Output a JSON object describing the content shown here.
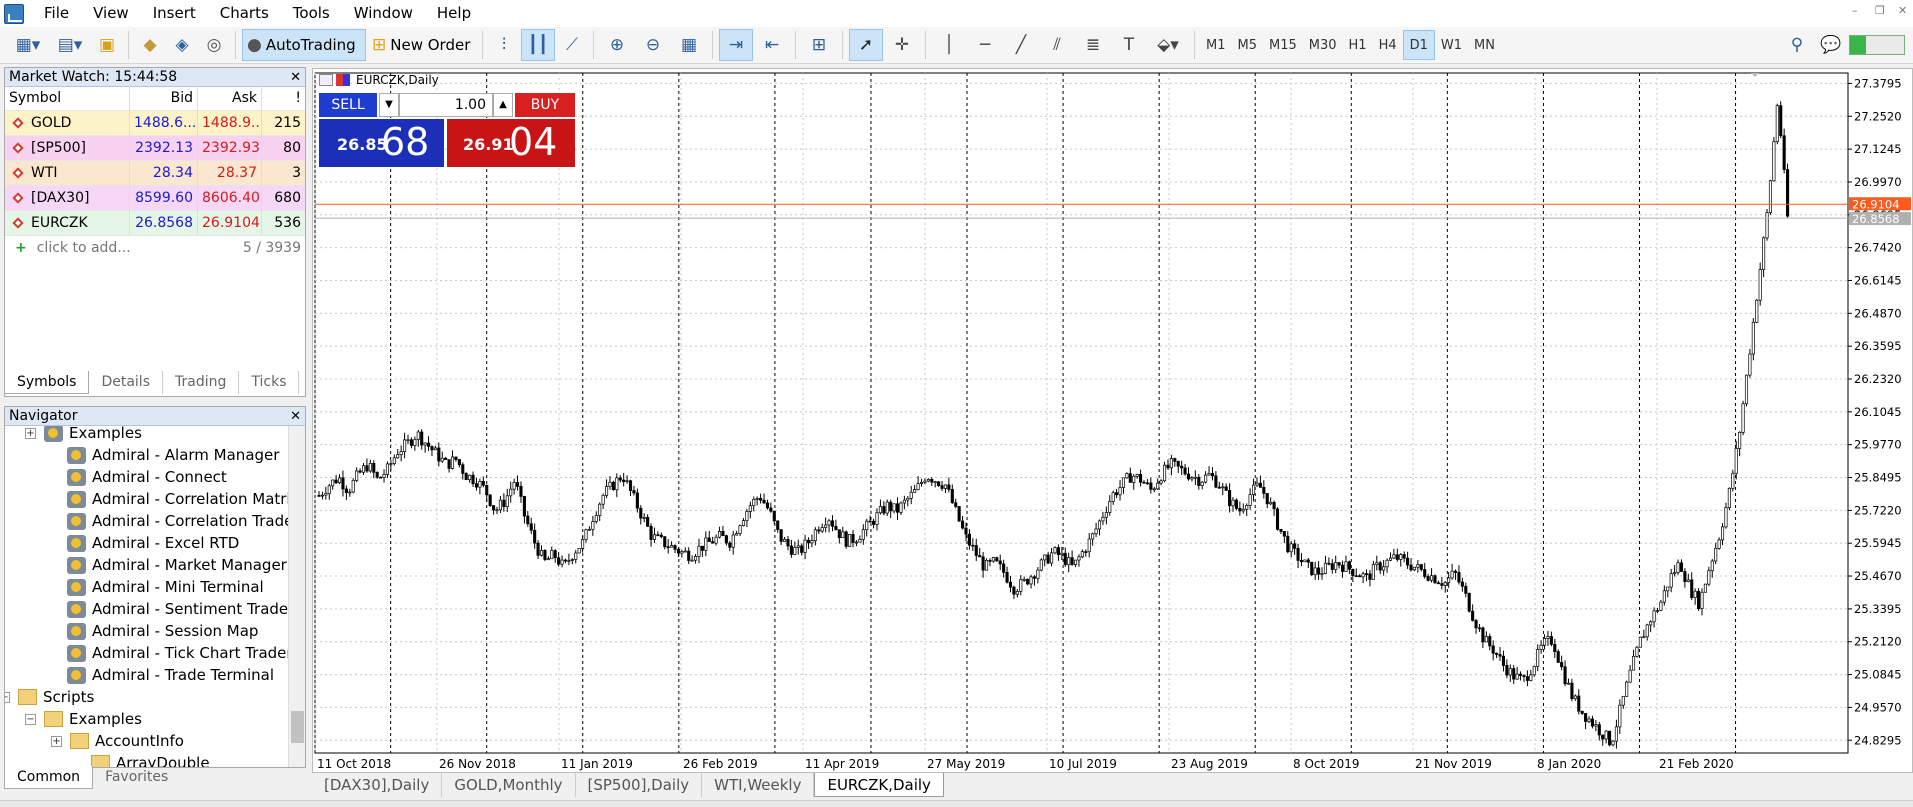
{
  "menu": [
    "File",
    "View",
    "Insert",
    "Charts",
    "Tools",
    "Window",
    "Help"
  ],
  "toolbar": {
    "autotrading": "AutoTrading",
    "new_order": "New Order",
    "timeframes": [
      "M1",
      "M5",
      "M15",
      "M30",
      "H1",
      "H4",
      "D1",
      "W1",
      "MN"
    ],
    "active_tf": "D1"
  },
  "market_watch": {
    "title": "Market Watch: 15:44:58",
    "columns": [
      "Symbol",
      "Bid",
      "Ask",
      "!"
    ],
    "rows": [
      {
        "symbol": "GOLD",
        "bid": "1488.6...",
        "ask": "1488.9...",
        "spread": "215",
        "bg": "#fdf3c9"
      },
      {
        "symbol": "[SP500]",
        "bid": "2392.13",
        "ask": "2392.93",
        "spread": "80",
        "bg": "#f8d3f1"
      },
      {
        "symbol": "WTI",
        "bid": "28.34",
        "ask": "28.37",
        "spread": "3",
        "bg": "#fbe6cf"
      },
      {
        "symbol": "[DAX30]",
        "bid": "8599.60",
        "ask": "8606.40",
        "spread": "680",
        "bg": "#f6d8f6"
      },
      {
        "symbol": "EURCZK",
        "bid": "26.8568",
        "ask": "26.9104",
        "spread": "536",
        "bg": "#e6f6e6"
      }
    ],
    "add_label": "click to add...",
    "count": "5 / 3939",
    "tabs": [
      "Symbols",
      "Details",
      "Trading",
      "Ticks"
    ]
  },
  "navigator": {
    "title": "Navigator",
    "items": [
      "Examples",
      "Admiral - Alarm Manager",
      "Admiral - Connect",
      "Admiral - Correlation Matrix",
      "Admiral - Correlation Trader",
      "Admiral - Excel RTD",
      "Admiral - Market Manager",
      "Admiral - Mini Terminal",
      "Admiral - Sentiment Trader",
      "Admiral - Session Map",
      "Admiral - Tick Chart Trader",
      "Admiral - Trade Terminal",
      "Scripts",
      "Examples",
      "AccountInfo",
      "ArrayDouble"
    ],
    "tabs": [
      "Common",
      "Favorites"
    ]
  },
  "chart": {
    "title": "EURCZK,Daily",
    "sell_label": "SELL",
    "buy_label": "BUY",
    "lot": "1.00",
    "sell_small": "26.85",
    "sell_big": "68",
    "buy_small": "26.91",
    "buy_big": "04",
    "ask_label": "26.9104",
    "bid_label": "26.8568",
    "colors": {
      "ask_line": "#ff5a1e",
      "bid_line": "#b0b0b0"
    }
  },
  "chart_data": {
    "type": "candlestick",
    "title": "EURCZK,Daily",
    "yticks": [
      "27.3795",
      "27.2520",
      "27.1245",
      "26.9970",
      "26.8695",
      "26.7420",
      "26.6145",
      "26.4870",
      "26.3595",
      "26.2320",
      "26.1045",
      "25.9770",
      "25.8495",
      "25.7220",
      "25.5945",
      "25.4670",
      "25.3395",
      "25.2120",
      "25.0845",
      "24.9570",
      "24.8295"
    ],
    "xticks": [
      "11 Oct 2018",
      "26 Nov 2018",
      "11 Jan 2019",
      "26 Feb 2019",
      "11 Apr 2019",
      "27 May 2019",
      "10 Jul 2019",
      "23 Aug 2019",
      "8 Oct 2019",
      "21 Nov 2019",
      "8 Jan 2020",
      "21 Feb 2020"
    ],
    "ylim": [
      24.78,
      27.42
    ],
    "path_points": [
      25.78,
      25.82,
      25.85,
      25.8,
      25.86,
      25.9,
      25.84,
      25.88,
      25.95,
      25.98,
      26.02,
      25.98,
      25.94,
      25.9,
      25.92,
      25.86,
      25.84,
      25.8,
      25.72,
      25.76,
      25.84,
      25.7,
      25.6,
      25.52,
      25.55,
      25.5,
      25.56,
      25.6,
      25.7,
      25.78,
      25.82,
      25.86,
      25.78,
      25.7,
      25.62,
      25.6,
      25.58,
      25.56,
      25.55,
      25.58,
      25.6,
      25.62,
      25.6,
      25.68,
      25.74,
      25.78,
      25.72,
      25.62,
      25.58,
      25.56,
      25.6,
      25.66,
      25.7,
      25.64,
      25.6,
      25.62,
      25.66,
      25.7,
      25.74,
      25.72,
      25.76,
      25.8,
      25.86,
      25.84,
      25.82,
      25.72,
      25.62,
      25.56,
      25.5,
      25.52,
      25.48,
      25.42,
      25.44,
      25.48,
      25.52,
      25.56,
      25.54,
      25.5,
      25.56,
      25.62,
      25.7,
      25.78,
      25.82,
      25.86,
      25.84,
      25.8,
      25.86,
      25.9,
      25.88,
      25.86,
      25.84,
      25.86,
      25.82,
      25.76,
      25.72,
      25.78,
      25.82,
      25.76,
      25.66,
      25.58,
      25.54,
      25.5,
      25.48,
      25.5,
      25.52,
      25.5,
      25.48,
      25.46,
      25.5,
      25.52,
      25.54,
      25.52,
      25.5,
      25.48,
      25.46,
      25.44,
      25.48,
      25.4,
      25.3,
      25.22,
      25.18,
      25.12,
      25.08,
      25.06,
      25.12,
      25.2,
      25.22,
      25.1,
      25.0,
      24.94,
      24.9,
      24.86,
      24.82,
      24.96,
      25.1,
      25.22,
      25.3,
      25.36,
      25.46,
      25.52,
      25.42,
      25.36,
      25.5,
      25.62,
      25.78,
      26.0,
      26.3,
      26.6,
      26.9,
      27.32,
      26.86
    ]
  },
  "chart_tabs": [
    "[DAX30],Daily",
    "GOLD,Monthly",
    "[SP500],Daily",
    "WTI,Weekly",
    "EURCZK,Daily"
  ],
  "active_chart_tab": "EURCZK,Daily"
}
